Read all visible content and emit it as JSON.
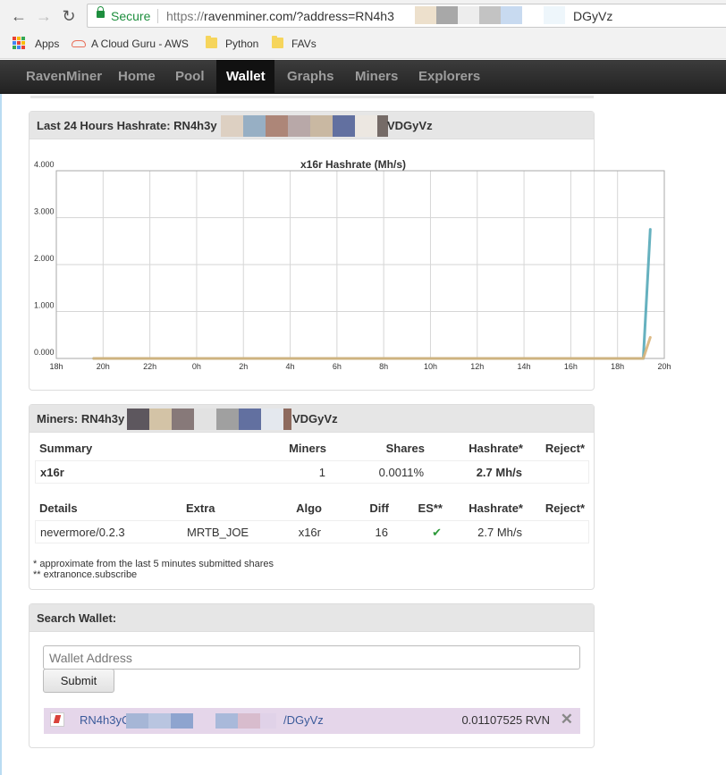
{
  "browser": {
    "back_icon": "arrow-left-icon",
    "forward_icon": "arrow-right-icon",
    "reload_icon": "reload-icon",
    "secure_label": "Secure",
    "url_scheme": "https://",
    "url_text": "ravenminer.com/?address=RN4h3",
    "url_tail": "DGyVz",
    "bookmarks": [
      {
        "label": "Apps",
        "icon": "apps-grid-icon"
      },
      {
        "label": "A Cloud Guru - AWS",
        "icon": "cloud-icon"
      },
      {
        "label": "Python",
        "icon": "folder-icon"
      },
      {
        "label": "FAVs",
        "icon": "folder-icon"
      }
    ]
  },
  "navbar": {
    "brand": "RavenMiner",
    "items": [
      {
        "label": "Home",
        "active": false
      },
      {
        "label": "Pool",
        "active": false
      },
      {
        "label": "Wallet",
        "active": true
      },
      {
        "label": "Graphs",
        "active": false
      },
      {
        "label": "Miners",
        "active": false
      },
      {
        "label": "Explorers",
        "active": false
      }
    ]
  },
  "hashrate_panel": {
    "title_prefix": "Last 24 Hours Hashrate: RN4h3y",
    "title_suffix": "VDGyVz"
  },
  "chart_data": {
    "type": "line",
    "title": "x16r Hashrate (Mh/s)",
    "xlabel": "",
    "ylabel": "",
    "x_ticks": [
      "18h",
      "20h",
      "22h",
      "0h",
      "2h",
      "4h",
      "6h",
      "8h",
      "10h",
      "12h",
      "14h",
      "16h",
      "18h",
      "20h"
    ],
    "y_ticks": [
      "0.000",
      "1.000",
      "2.000",
      "3.000",
      "4.000"
    ],
    "x_range_hours": [
      0,
      26
    ],
    "ylim": [
      0,
      4
    ],
    "grid": true,
    "series": [
      {
        "color": "#55a8b8",
        "points": [
          [
            1.6,
            0
          ],
          [
            24.9,
            0
          ],
          [
            25.1,
            0
          ],
          [
            25.4,
            2.75
          ]
        ]
      },
      {
        "color": "#d9b47a",
        "points": [
          [
            1.6,
            0
          ],
          [
            24.9,
            0
          ],
          [
            25.1,
            0
          ],
          [
            25.4,
            0.45
          ]
        ]
      }
    ]
  },
  "miners_panel": {
    "title_prefix": "Miners: RN4h3y",
    "title_suffix": "VDGyVz",
    "summary_headers": [
      "Summary",
      "Miners",
      "Shares",
      "Hashrate*",
      "Reject*"
    ],
    "summary_row": {
      "algo": "x16r",
      "miners": "1",
      "shares": "0.0011%",
      "hashrate": "2.7 Mh/s",
      "reject": ""
    },
    "details_headers": [
      "Details",
      "Extra",
      "Algo",
      "Diff",
      "ES**",
      "Hashrate*",
      "Reject*"
    ],
    "details_row": {
      "details": "nevermore/0.2.3",
      "extra": "MRTB_JOE",
      "algo": "x16r",
      "diff": "16",
      "es": "✔",
      "hashrate": "2.7 Mh/s",
      "reject": ""
    },
    "note1": "* approximate from the last 5 minutes submitted shares",
    "note2": "** extranonce.subscribe"
  },
  "search_panel": {
    "title": "Search Wallet:",
    "placeholder": "Wallet Address",
    "submit_label": "Submit",
    "wallet_prefix": "RN4h3yC",
    "wallet_suffix": "/DGyVz",
    "balance": "0.01107525 RVN",
    "close_icon": "close-icon"
  }
}
